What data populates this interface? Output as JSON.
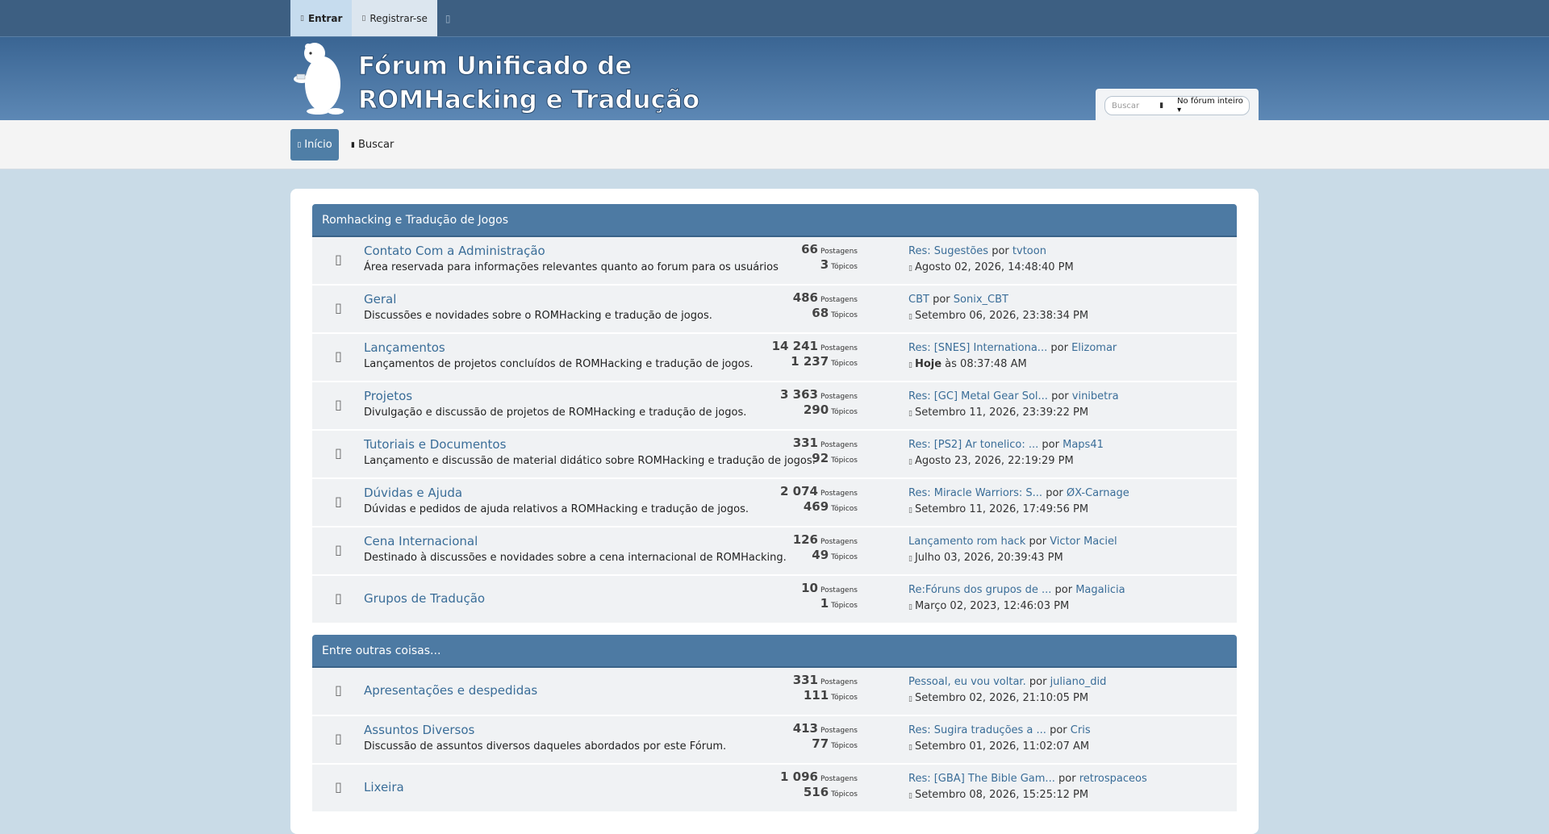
{
  "topbar": {
    "login": "Entrar",
    "register": "Registrar-se",
    "more_icon": ""
  },
  "header": {
    "logo_line1": "Fórum Unificado de",
    "logo_line2": "ROMHacking e Tradução"
  },
  "search": {
    "placeholder": "Buscar",
    "scope": "No fórum inteiro"
  },
  "menu": {
    "home": "Início",
    "search": "Buscar"
  },
  "categories": [
    {
      "title": "Romhacking e Tradução de Jogos",
      "boards": [
        {
          "name": "Contato Com a Administração",
          "desc": "Área reservada para informações relevantes quanto ao forum para os usuários",
          "posts": "66",
          "topics": "3",
          "last_title": "Res: Sugestões",
          "last_user": "tvtoon",
          "last_date": "Agosto 02, 2026, 14:48:40 PM"
        },
        {
          "name": "Geral",
          "desc": "Discussões e novidades sobre o ROMHacking e tradução de jogos.",
          "posts": "486",
          "topics": "68",
          "last_title": "CBT",
          "last_user": "Sonix_CBT",
          "last_date": "Setembro 06, 2026, 23:38:34 PM"
        },
        {
          "name": "Lançamentos",
          "desc": "Lançamentos de projetos concluídos de ROMHacking e tradução de jogos.",
          "posts": "14 241",
          "topics": "1 237",
          "last_title": "Res: [SNES] Internationa...",
          "last_user": "Elizomar",
          "last_date_bold": "Hoje",
          "last_date": " às 08:37:48 AM"
        },
        {
          "name": "Projetos",
          "desc": "Divulgação e discussão de projetos de ROMHacking e tradução de jogos.",
          "posts": "3 363",
          "topics": "290",
          "last_title": "Res: [GC] Metal Gear Sol...",
          "last_user": "vinibetra",
          "last_date": "Setembro 11, 2026, 23:39:22 PM"
        },
        {
          "name": "Tutoriais e Documentos",
          "desc": "Lançamento e discussão de material didático sobre ROMHacking e tradução de jogos.",
          "posts": "331",
          "topics": "92",
          "last_title": "Res: [PS2] Ar tonelico: ...",
          "last_user": "Maps41",
          "last_date": "Agosto 23, 2026, 22:19:29 PM"
        },
        {
          "name": "Dúvidas e Ajuda",
          "desc": "Dúvidas e pedidos de ajuda relativos a ROMHacking e tradução de jogos.",
          "posts": "2 074",
          "topics": "469",
          "last_title": "Res: Miracle Warriors: S...",
          "last_user": "ØX-Carnage",
          "last_date": "Setembro 11, 2026, 17:49:56 PM"
        },
        {
          "name": "Cena Internacional",
          "desc": "Destinado à discussões e novidades sobre a cena internacional de ROMHacking.",
          "posts": "126",
          "topics": "49",
          "last_title": "Lançamento rom hack",
          "last_user": "Victor Maciel",
          "last_date": "Julho 03, 2026, 20:39:43 PM"
        },
        {
          "name": "Grupos de Tradução",
          "desc": "",
          "posts": "10",
          "topics": "1",
          "last_title": "Re:Fóruns dos grupos de ...",
          "last_user": "Magalicia",
          "last_date": "Março 02, 2023, 12:46:03 PM"
        }
      ]
    },
    {
      "title": "Entre outras coisas...",
      "boards": [
        {
          "name": "Apresentações e despedidas",
          "desc": "",
          "posts": "331",
          "topics": "111",
          "last_title": "Pessoal, eu vou voltar.",
          "last_user": "juliano_did",
          "last_date": "Setembro 02, 2026, 21:10:05 PM"
        },
        {
          "name": "Assuntos Diversos",
          "desc": "Discussão de assuntos diversos daqueles abordados por este Fórum.",
          "posts": "413",
          "topics": "77",
          "last_title": "Res: Sugira traduções a ...",
          "last_user": "Cris",
          "last_date": "Setembro 01, 2026, 11:02:07 AM"
        },
        {
          "name": "Lixeira",
          "desc": "",
          "posts": "1 096",
          "topics": "516",
          "last_title": "Res: [GBA] The Bible Gam...",
          "last_user": "retrospaceos",
          "last_date": "Setembro 08, 2026, 15:25:12 PM"
        }
      ]
    }
  ],
  "labels": {
    "posts": "Postagens",
    "topics": "Tópicos",
    "by": "por"
  },
  "colors": {
    "accent": "#4d7aa3",
    "link": "#3a6d98",
    "topbar": "#3d5f82"
  }
}
